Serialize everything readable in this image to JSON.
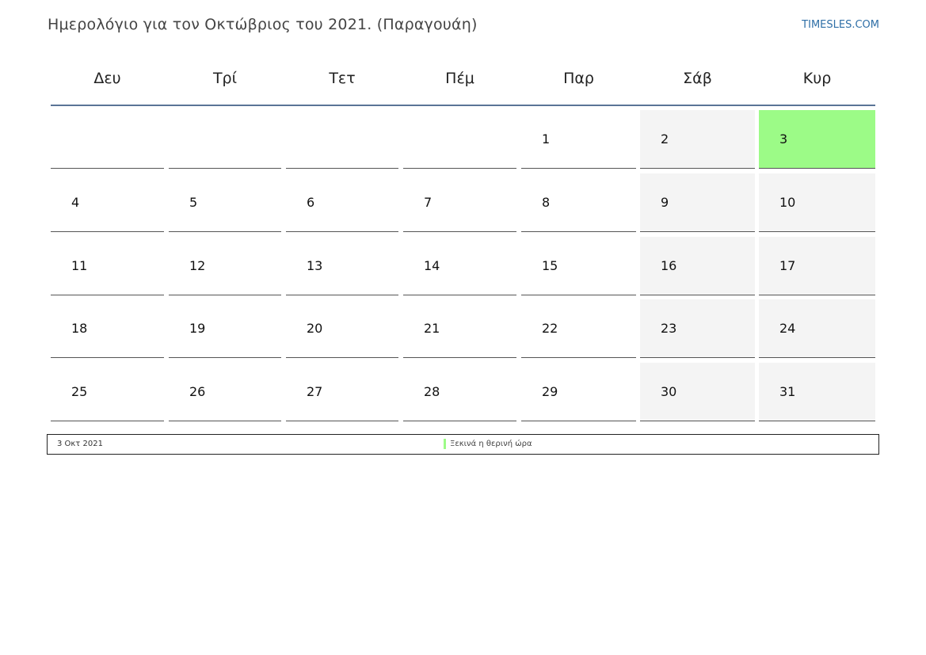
{
  "header": {
    "title": "Ημερολόγιο για τον Οκτώβριος του 2021. (Παραγουάη)",
    "brand": "TIMESLES.COM"
  },
  "weekdays": [
    "Δευ",
    "Τρί",
    "Τετ",
    "Πέμ",
    "Παρ",
    "Σάβ",
    "Κυρ"
  ],
  "weeks": [
    [
      "",
      "",
      "",
      "",
      "1",
      "2",
      "3"
    ],
    [
      "4",
      "5",
      "6",
      "7",
      "8",
      "9",
      "10"
    ],
    [
      "11",
      "12",
      "13",
      "14",
      "15",
      "16",
      "17"
    ],
    [
      "18",
      "19",
      "20",
      "21",
      "22",
      "23",
      "24"
    ],
    [
      "25",
      "26",
      "27",
      "28",
      "29",
      "30",
      "31"
    ]
  ],
  "weekend_columns": [
    5,
    6
  ],
  "highlighted_day": "3",
  "colors": {
    "highlight": "#9cfb87",
    "weekend": "#f4f4f4",
    "header_rule": "#5a7496",
    "brand": "#2f6fa7"
  },
  "legend": {
    "date": "3 Οκτ 2021",
    "event": "Ξεκινά η θερινή ώρα"
  }
}
